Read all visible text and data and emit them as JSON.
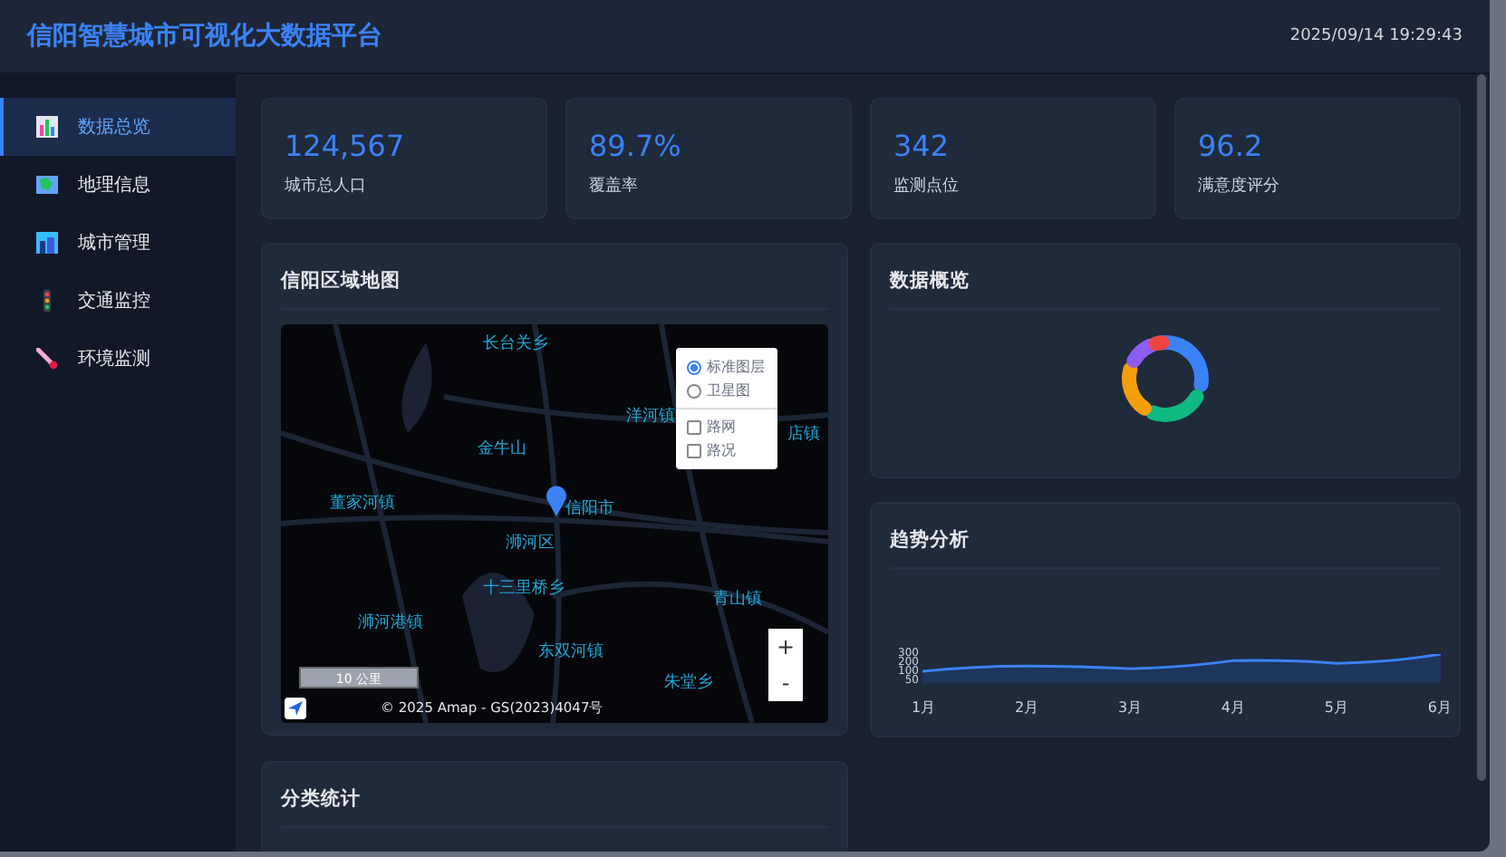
{
  "header": {
    "title": "信阳智慧城市可视化大数据平台",
    "datetime": "2025/09/14 19:29:43"
  },
  "sidebar": {
    "items": [
      {
        "label": "数据总览",
        "selected": true
      },
      {
        "label": "地理信息",
        "selected": false
      },
      {
        "label": "城市管理",
        "selected": false
      },
      {
        "label": "交通监控",
        "selected": false
      },
      {
        "label": "环境监测",
        "selected": false
      }
    ]
  },
  "stats": [
    {
      "value": "124,567",
      "label": "城市总人口"
    },
    {
      "value": "89.7%",
      "label": "覆盖率"
    },
    {
      "value": "342",
      "label": "监测点位"
    },
    {
      "value": "96.2",
      "label": "满意度评分"
    }
  ],
  "map_panel": {
    "title": "信阳区域地图",
    "places": [
      {
        "name": "长台关乡"
      },
      {
        "name": "洋河镇"
      },
      {
        "name": "店镇"
      },
      {
        "name": "金牛山"
      },
      {
        "name": "董家河镇"
      },
      {
        "name": "信阳市"
      },
      {
        "name": "浉河区"
      },
      {
        "name": "十三里桥乡"
      },
      {
        "name": "青山镇"
      },
      {
        "name": "浉河港镇"
      },
      {
        "name": "东双河镇"
      },
      {
        "name": "朱堂乡"
      }
    ],
    "layers": [
      {
        "label": "标准图层",
        "kind": "radio",
        "selected": true
      },
      {
        "label": "卫星图",
        "kind": "radio",
        "selected": false
      },
      {
        "label": "路网",
        "kind": "checkbox",
        "selected": false
      },
      {
        "label": "路况",
        "kind": "checkbox",
        "selected": false
      }
    ],
    "zoom_in": "+",
    "zoom_out": "-",
    "scale": "10 公里",
    "attribution": "© 2025 Amap - GS(2023)4047号"
  },
  "overview_panel": {
    "title": "数据概览"
  },
  "trend_panel": {
    "title": "趋势分析",
    "y_labels": [
      "300",
      "200",
      "100",
      "50"
    ],
    "x_labels": [
      "1月",
      "2月",
      "3月",
      "4月",
      "5月",
      "6月"
    ]
  },
  "category_panel": {
    "title": "分类统计"
  }
}
